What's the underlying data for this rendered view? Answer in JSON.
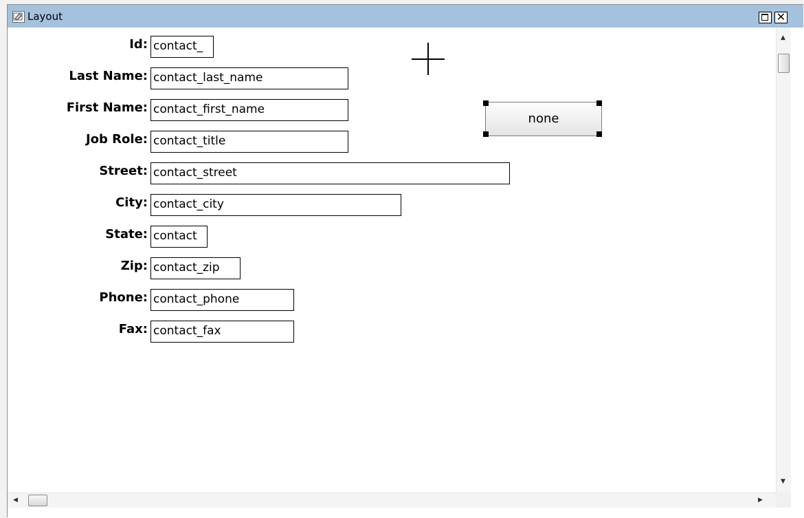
{
  "window": {
    "title": "Layout",
    "maximize_label": "",
    "close_label": "✕"
  },
  "form": {
    "fields": [
      {
        "label": "Id:",
        "value": "contact_"
      },
      {
        "label": "Last Name:",
        "value": "contact_last_name"
      },
      {
        "label": "First Name:",
        "value": "contact_first_name"
      },
      {
        "label": "Job Role:",
        "value": "contact_title"
      },
      {
        "label": "Street:",
        "value": "contact_street"
      },
      {
        "label": "City:",
        "value": "contact_city"
      },
      {
        "label": "State:",
        "value": "contact"
      },
      {
        "label": "Zip:",
        "value": "contact_zip"
      },
      {
        "label": "Phone:",
        "value": "contact_phone"
      },
      {
        "label": "Fax:",
        "value": "contact_fax"
      }
    ]
  },
  "button": {
    "label": "none",
    "selected": true
  },
  "icons": {
    "title_icon": "layout-window-icon",
    "crosshair": "crosshair-cursor-icon"
  },
  "colors": {
    "titlebar": "#a4c1de",
    "field_border": "#000000"
  }
}
